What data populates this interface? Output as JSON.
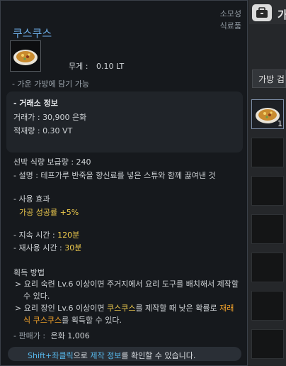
{
  "item": {
    "title": "쿠스쿠스",
    "category_line1": "소모성",
    "category_line2": "식료품",
    "icon": "couscous-dish-icon",
    "weight_label": "무게 :",
    "weight_value": "0.10 LT",
    "bag_note": "- 가운 가방에 담기 가능"
  },
  "market": {
    "title": "- 거래소 정보",
    "price_label": "거래가 :",
    "price_value": "30,900 은화",
    "stock_label": "적재량 :",
    "stock_value": "0.30 VT"
  },
  "ship_food": "선박 식량 보급량 : 240",
  "description": "- 설명 : 테프가루 반죽을 향신료를 넣은 스튜와 함께 끓여낸 것",
  "effect": {
    "header": "- 사용 효과",
    "value": "가공 성공률 +5%"
  },
  "duration": {
    "label": "- 지속 시간 :",
    "value": "120분"
  },
  "cooldown": {
    "label": "- 재사용 시간 :",
    "value": "30분"
  },
  "acquire": {
    "header": "획득 방법",
    "line1": "> 요리 숙련 Lv.6 이상이면 주거지에서 요리 도구를 배치해서 제작할",
    "line2": "수 있다.",
    "line3_pre": "> 요리 장인 Lv.6 이상이면 ",
    "line3_hl1": "쿠스쿠스",
    "line3_mid": "를 제작할 때 낮은 확률로 ",
    "line3_hl2": "재래",
    "line4_hl": "식 쿠스쿠스",
    "line4_post": "를 획득할 수 있다."
  },
  "sell_price": {
    "label": "- 판매가 :",
    "value": "은화 1,006"
  },
  "hint": {
    "key": "Shift+좌클릭",
    "mid": "으로 ",
    "target": "제작 정보",
    "post": "를 확인할 수 있습니다."
  },
  "bag_panel": {
    "title_partial": "가",
    "search_tab": "가방 검",
    "slot_qty": "1",
    "bag_icon": "bag-window-icon"
  }
}
